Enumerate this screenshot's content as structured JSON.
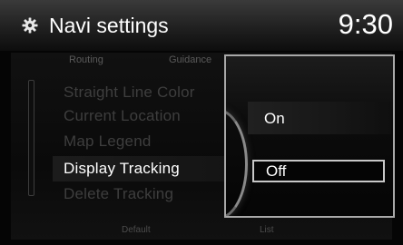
{
  "header": {
    "title": "Navi settings",
    "clock": "9:30",
    "icon": "gear-icon"
  },
  "tabs": [
    {
      "label": "Routing"
    },
    {
      "label": "Guidance"
    }
  ],
  "menu": {
    "items": [
      {
        "label": "Straight Line Color"
      },
      {
        "label": "Current Location"
      },
      {
        "label": "Map Legend"
      },
      {
        "label": "Display Tracking",
        "selected": true
      },
      {
        "label": "Delete Tracking"
      }
    ]
  },
  "footer": {
    "default_label": "Default",
    "list_label": "List"
  },
  "popup": {
    "options": [
      {
        "label": "On"
      },
      {
        "label": "Off",
        "selected": true
      }
    ]
  },
  "colors": {
    "selection_border": "#c8c8c8",
    "popup_border": "#a8a8a8",
    "dim_text": "#3e3e3e"
  }
}
